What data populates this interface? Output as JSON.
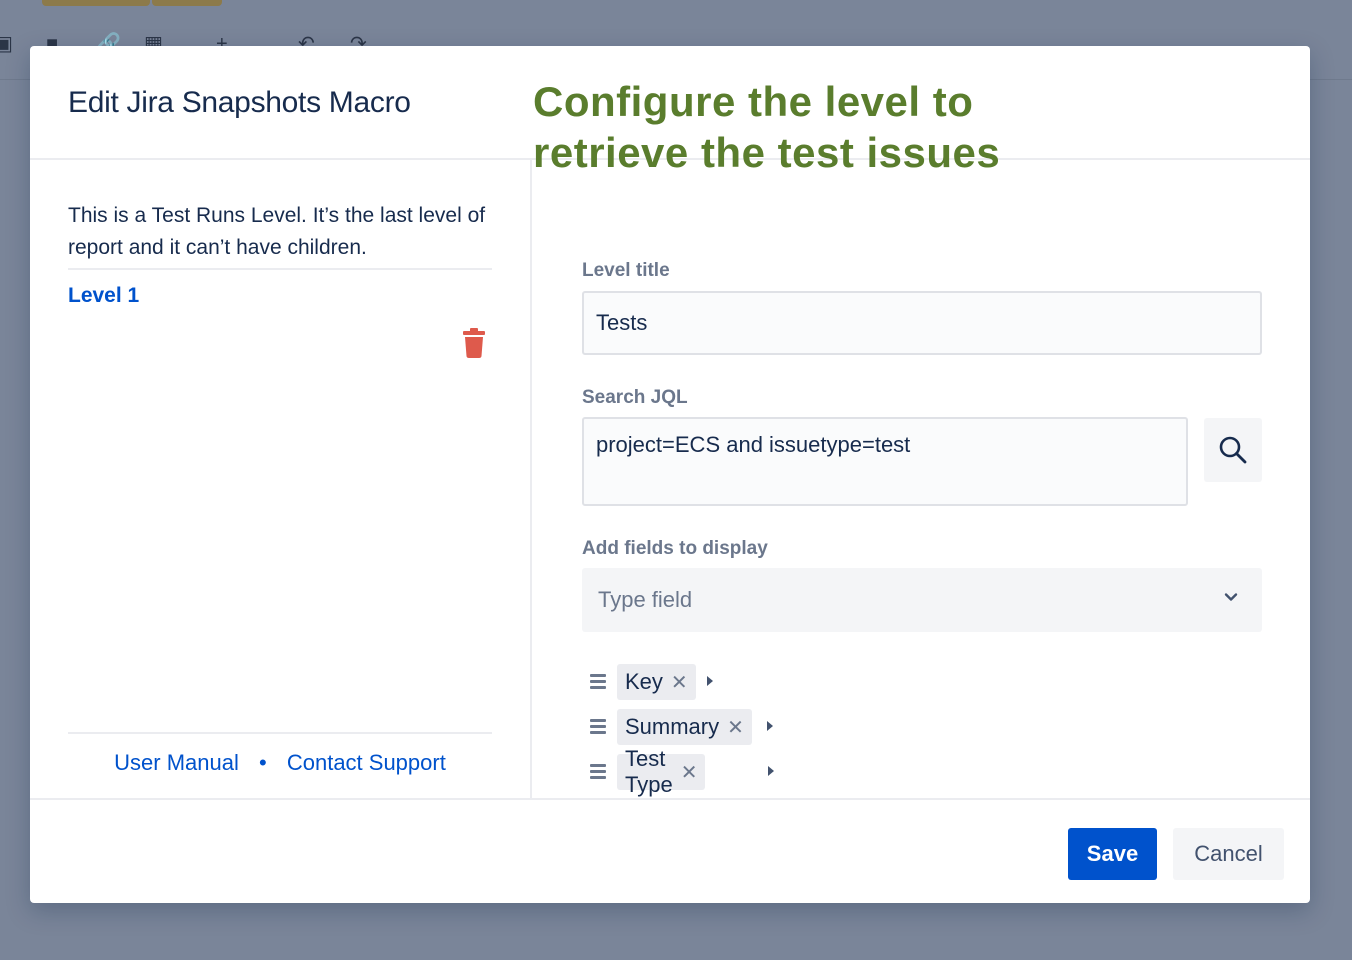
{
  "modal": {
    "title": "Edit Jira Snapshots Macro"
  },
  "annotation": {
    "line1": "Configure the level to",
    "line2": "retrieve the test issues",
    "color": "#5a7d2d"
  },
  "left_pane": {
    "description": "This is a Test Runs Level. It’s the last level of report and it can’t have children.",
    "level_label": "Level 1",
    "delete_icon": "trash-icon",
    "delete_color": "#de5a4c",
    "footer": {
      "user_manual": "User Manual",
      "separator": "•",
      "contact_support": "Contact Support"
    }
  },
  "form": {
    "level_title_label": "Level title",
    "level_title_value": "Tests",
    "jql_label": "Search JQL",
    "jql_value": "project=ECS and issuetype=test",
    "search_icon": "search-icon",
    "fields_label": "Add fields to display",
    "fields_placeholder": "Type field",
    "selected_fields": [
      {
        "name": "Key"
      },
      {
        "name": "Summary"
      },
      {
        "name": "Test Type"
      }
    ]
  },
  "buttons": {
    "save": "Save",
    "cancel": "Cancel",
    "primary_color": "#0052cc"
  }
}
